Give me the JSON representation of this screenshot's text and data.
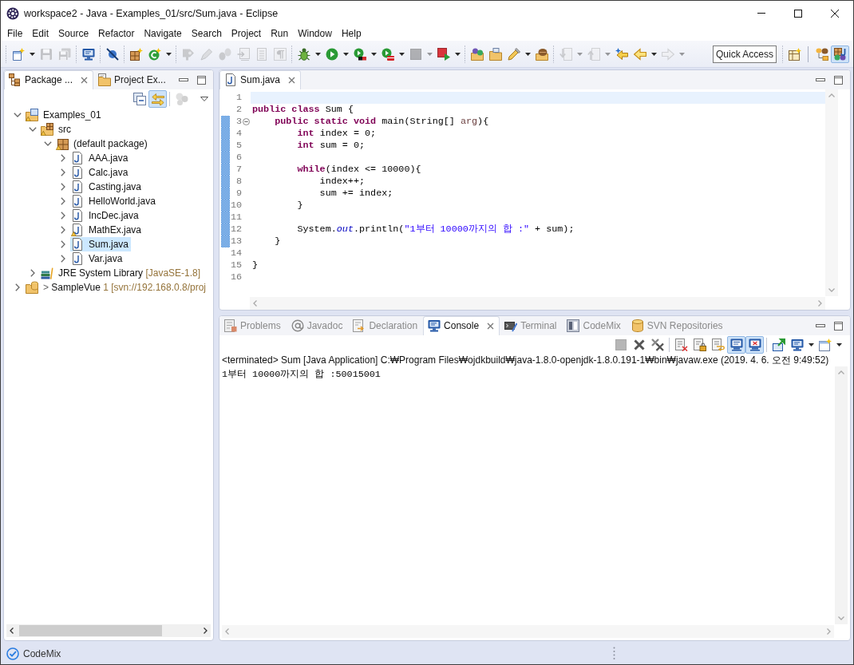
{
  "window": {
    "title": "workspace2 - Java - Examples_01/src/Sum.java - Eclipse"
  },
  "menu": [
    "File",
    "Edit",
    "Source",
    "Refactor",
    "Navigate",
    "Search",
    "Project",
    "Run",
    "Window",
    "Help"
  ],
  "toolbar": {
    "groups": [
      {
        "items": [
          {
            "kind": "split",
            "disabled": false
          },
          {
            "kind": "button",
            "disabled": true
          },
          {
            "kind": "button",
            "disabled": true
          }
        ]
      },
      {
        "items": [
          {
            "kind": "button",
            "disabled": false
          }
        ]
      },
      {
        "items": [
          {
            "kind": "button",
            "disabled": false
          }
        ]
      },
      {
        "items": [
          {
            "kind": "button",
            "disabled": false
          },
          {
            "kind": "split",
            "disabled": false
          }
        ]
      },
      {
        "items": [
          {
            "kind": "button",
            "disabled": true
          },
          {
            "kind": "button",
            "disabled": true
          },
          {
            "kind": "button",
            "disabled": true
          },
          {
            "kind": "button",
            "disabled": true
          },
          {
            "kind": "button",
            "disabled": true
          },
          {
            "kind": "button",
            "disabled": true
          }
        ]
      },
      {
        "items": [
          {
            "kind": "split",
            "disabled": false
          },
          {
            "kind": "split",
            "disabled": false
          },
          {
            "kind": "split",
            "disabled": false
          },
          {
            "kind": "split",
            "disabled": false
          },
          {
            "kind": "split",
            "disabled": true
          },
          {
            "kind": "split",
            "disabled": false
          }
        ]
      },
      {
        "items": [
          {
            "kind": "button",
            "disabled": false
          },
          {
            "kind": "button",
            "disabled": false
          },
          {
            "kind": "split",
            "disabled": false
          },
          {
            "kind": "button",
            "disabled": false
          }
        ]
      },
      {
        "items": [
          {
            "kind": "split",
            "disabled": true
          },
          {
            "kind": "split",
            "disabled": true
          },
          {
            "kind": "button",
            "disabled": false
          },
          {
            "kind": "split",
            "disabled": false
          },
          {
            "kind": "split",
            "disabled": true
          }
        ]
      }
    ],
    "quick_access": {
      "placeholder": "Quick Access"
    },
    "perspectives": [
      {
        "selected": false
      },
      {
        "selected": true
      }
    ]
  },
  "package_explorer": {
    "tabs": [
      {
        "label": "Package ...",
        "selected": true
      },
      {
        "label": "Project Ex...",
        "selected": false
      }
    ],
    "view_toolbar": {
      "groups": [
        {
          "items": [
            {
              "kind": "button",
              "selected": false,
              "disabled": false
            },
            {
              "kind": "button",
              "selected": true,
              "disabled": false
            }
          ]
        },
        {
          "items": [
            {
              "kind": "button",
              "selected": false,
              "disabled": true
            }
          ]
        }
      ]
    },
    "tree": [
      {
        "label": "Examples_01",
        "kind": "project",
        "expanded": true,
        "selected": false,
        "warning": true,
        "children": [
          {
            "label": "src",
            "kind": "source-folder",
            "expanded": true,
            "selected": false,
            "warning": true,
            "children": [
              {
                "label": "(default package)",
                "kind": "package",
                "expanded": true,
                "selected": false,
                "warning": true,
                "children": [
                  {
                    "label": "AAA.java",
                    "kind": "java-file",
                    "expanded": false,
                    "selected": false,
                    "warning": false
                  },
                  {
                    "label": "Calc.java",
                    "kind": "java-file",
                    "expanded": false,
                    "selected": false,
                    "warning": false
                  },
                  {
                    "label": "Casting.java",
                    "kind": "java-file",
                    "expanded": false,
                    "selected": false,
                    "warning": false
                  },
                  {
                    "label": "HelloWorld.java",
                    "kind": "java-file",
                    "expanded": false,
                    "selected": false,
                    "warning": false
                  },
                  {
                    "label": "IncDec.java",
                    "kind": "java-file",
                    "expanded": false,
                    "selected": false,
                    "warning": false
                  },
                  {
                    "label": "MathEx.java",
                    "kind": "java-file",
                    "expanded": false,
                    "selected": false,
                    "warning": true
                  },
                  {
                    "label": "Sum.java",
                    "kind": "java-file",
                    "expanded": false,
                    "selected": true,
                    "warning": false
                  },
                  {
                    "label": "Var.java",
                    "kind": "java-file",
                    "expanded": false,
                    "selected": false,
                    "warning": false
                  }
                ]
              }
            ]
          },
          {
            "label": "JRE System Library",
            "decoration": "[JavaSE-1.8]",
            "kind": "library",
            "expanded": false,
            "selected": false,
            "warning": false
          }
        ]
      },
      {
        "prefix": "> ",
        "label": "SampleVue",
        "decoration": "1 [svn://192.168.0.8/proj",
        "kind": "svn-project",
        "expanded": false,
        "selected": false,
        "warning": false
      }
    ]
  },
  "editor": {
    "tabs": [
      {
        "label": "Sum.java",
        "selected": true
      }
    ],
    "lines": [
      {
        "number": "1",
        "current": true,
        "changed": false
      },
      {
        "number": "2",
        "current": false,
        "changed": false,
        "tokens": [
          {
            "kind": "keyword",
            "text": "public "
          },
          {
            "kind": "keyword",
            "text": "class "
          },
          {
            "kind": "plain",
            "text": "Sum {"
          }
        ]
      },
      {
        "number": "3",
        "current": false,
        "changed": true,
        "collapsible": true,
        "tokens": [
          {
            "kind": "keyword",
            "text": "    public "
          },
          {
            "kind": "keyword",
            "text": "static "
          },
          {
            "kind": "keyword",
            "text": "void "
          },
          {
            "kind": "plain",
            "text": "main(String[] "
          },
          {
            "kind": "param",
            "text": "arg"
          },
          {
            "kind": "plain",
            "text": "){"
          }
        ]
      },
      {
        "number": "4",
        "current": false,
        "changed": true,
        "tokens": [
          {
            "kind": "keyword",
            "text": "        int "
          },
          {
            "kind": "plain",
            "text": "index = 0;"
          }
        ]
      },
      {
        "number": "5",
        "current": false,
        "changed": true,
        "tokens": [
          {
            "kind": "keyword",
            "text": "        int "
          },
          {
            "kind": "plain",
            "text": "sum = 0;"
          }
        ]
      },
      {
        "number": "6",
        "current": false,
        "changed": true
      },
      {
        "number": "7",
        "current": false,
        "changed": true,
        "tokens": [
          {
            "kind": "keyword",
            "text": "        while"
          },
          {
            "kind": "plain",
            "text": "(index <= 10000){"
          }
        ]
      },
      {
        "number": "8",
        "current": false,
        "changed": true,
        "tokens": [
          {
            "kind": "plain",
            "text": "            index++;"
          }
        ]
      },
      {
        "number": "9",
        "current": false,
        "changed": true,
        "tokens": [
          {
            "kind": "plain",
            "text": "            sum += index;"
          }
        ]
      },
      {
        "number": "10",
        "current": false,
        "changed": true,
        "tokens": [
          {
            "kind": "plain",
            "text": "        }"
          }
        ]
      },
      {
        "number": "11",
        "current": false,
        "changed": true
      },
      {
        "number": "12",
        "current": false,
        "changed": true,
        "tokens": [
          {
            "kind": "plain",
            "text": "        System."
          },
          {
            "kind": "static-field",
            "text": "out"
          },
          {
            "kind": "plain",
            "text": ".println("
          },
          {
            "kind": "string",
            "text": "\"1부터 10000까지의 합 :\""
          },
          {
            "kind": "plain",
            "text": " + sum);"
          }
        ]
      },
      {
        "number": "13",
        "current": false,
        "changed": true,
        "tokens": [
          {
            "kind": "plain",
            "text": "    }"
          }
        ]
      },
      {
        "number": "14",
        "current": false,
        "changed": false
      },
      {
        "number": "15",
        "current": false,
        "changed": false,
        "tokens": [
          {
            "kind": "plain",
            "text": "}"
          }
        ]
      },
      {
        "number": "16",
        "current": false,
        "changed": false
      }
    ]
  },
  "console": {
    "tabs": [
      {
        "label": "Problems",
        "selected": false
      },
      {
        "label": "Javadoc",
        "selected": false
      },
      {
        "label": "Declaration",
        "selected": false
      },
      {
        "label": "Console",
        "selected": true
      },
      {
        "label": "Terminal",
        "selected": false
      },
      {
        "label": "CodeMix",
        "selected": false
      },
      {
        "label": "SVN Repositories",
        "selected": false
      }
    ],
    "toolbar": {
      "groups": [
        {
          "items": [
            {
              "kind": "button",
              "selected": false,
              "disabled": true
            },
            {
              "kind": "button",
              "selected": false,
              "disabled": false
            },
            {
              "kind": "button",
              "selected": false,
              "disabled": false
            }
          ]
        },
        {
          "items": [
            {
              "kind": "button",
              "selected": false,
              "disabled": false
            },
            {
              "kind": "button",
              "selected": false,
              "disabled": false
            },
            {
              "kind": "button",
              "selected": false,
              "disabled": false
            },
            {
              "kind": "button",
              "selected": true,
              "disabled": false
            },
            {
              "kind": "button",
              "selected": true,
              "disabled": false
            }
          ]
        },
        {
          "items": [
            {
              "kind": "button",
              "selected": false,
              "disabled": false
            },
            {
              "kind": "split",
              "selected": false,
              "disabled": false
            },
            {
              "kind": "split",
              "selected": false,
              "disabled": false
            }
          ]
        }
      ]
    },
    "process": "<terminated> Sum [Java Application] C:₩Program Files₩ojdkbuild₩java-1.8.0-openjdk-1.8.0.191-1₩bin₩javaw.exe (2019. 4. 6. 오전 9:49:52)",
    "output": [
      "1부터 10000까지의 합 :50015001"
    ]
  },
  "status_bar": {
    "label": "CodeMix"
  }
}
